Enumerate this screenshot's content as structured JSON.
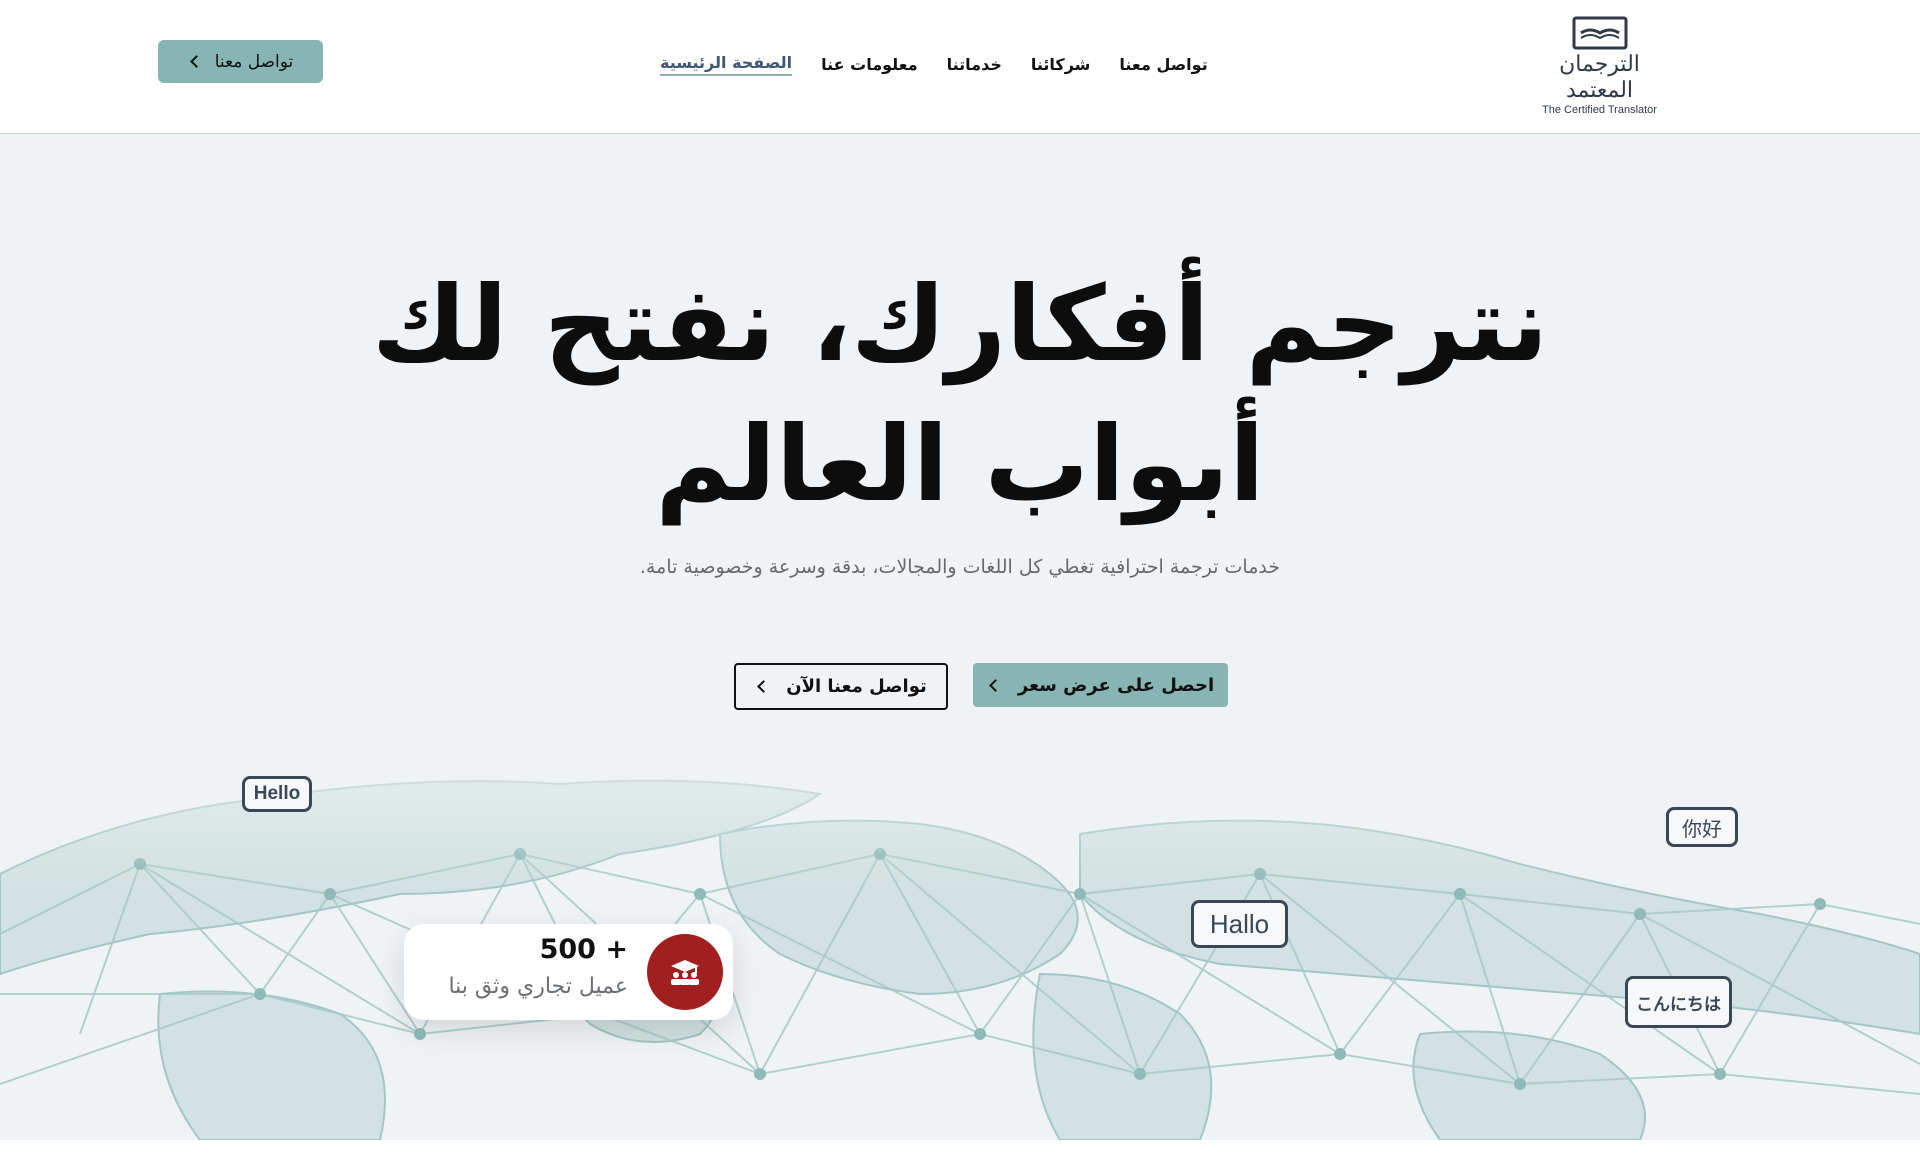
{
  "header": {
    "logo": {
      "arabic": "الترجمان المعتمد",
      "english": "The Certified Translator",
      "icon": "open-book-icon"
    },
    "nav": [
      {
        "label": "الصفحة الرئيسية",
        "active": true
      },
      {
        "label": "معلومات عنا",
        "active": false
      },
      {
        "label": "خدماتنا",
        "active": false
      },
      {
        "label": "شركائنا",
        "active": false
      },
      {
        "label": "تواصل معنا",
        "active": false
      }
    ],
    "cta_label": "تواصل معنا"
  },
  "hero": {
    "title_line1": "نترجم أفكارك، نفتح لك",
    "title_line2": "أبواب العالم",
    "subtitle": "خدمات ترجمة احترافية تغطي كل اللغات والمجالات، بدقة وسرعة وخصوصية تامة.",
    "primary_button": "احصل على عرض سعر",
    "secondary_button": "تواصل معنا الآن",
    "bubbles": {
      "hello": "Hello",
      "hallo": "Hallo",
      "chinese": "你好",
      "japanese": "こんにちは"
    },
    "stat": {
      "number": "+ 500",
      "label": "عميل تجاري وثق بنا",
      "icon": "graduates-group-icon"
    }
  },
  "colors": {
    "accent": "#86b5b4",
    "hero_bg": "#eff3f5",
    "stat_icon_bg": "#a01f1f",
    "text_dark": "#0d0d0d",
    "nav_active": "#3f5873"
  }
}
